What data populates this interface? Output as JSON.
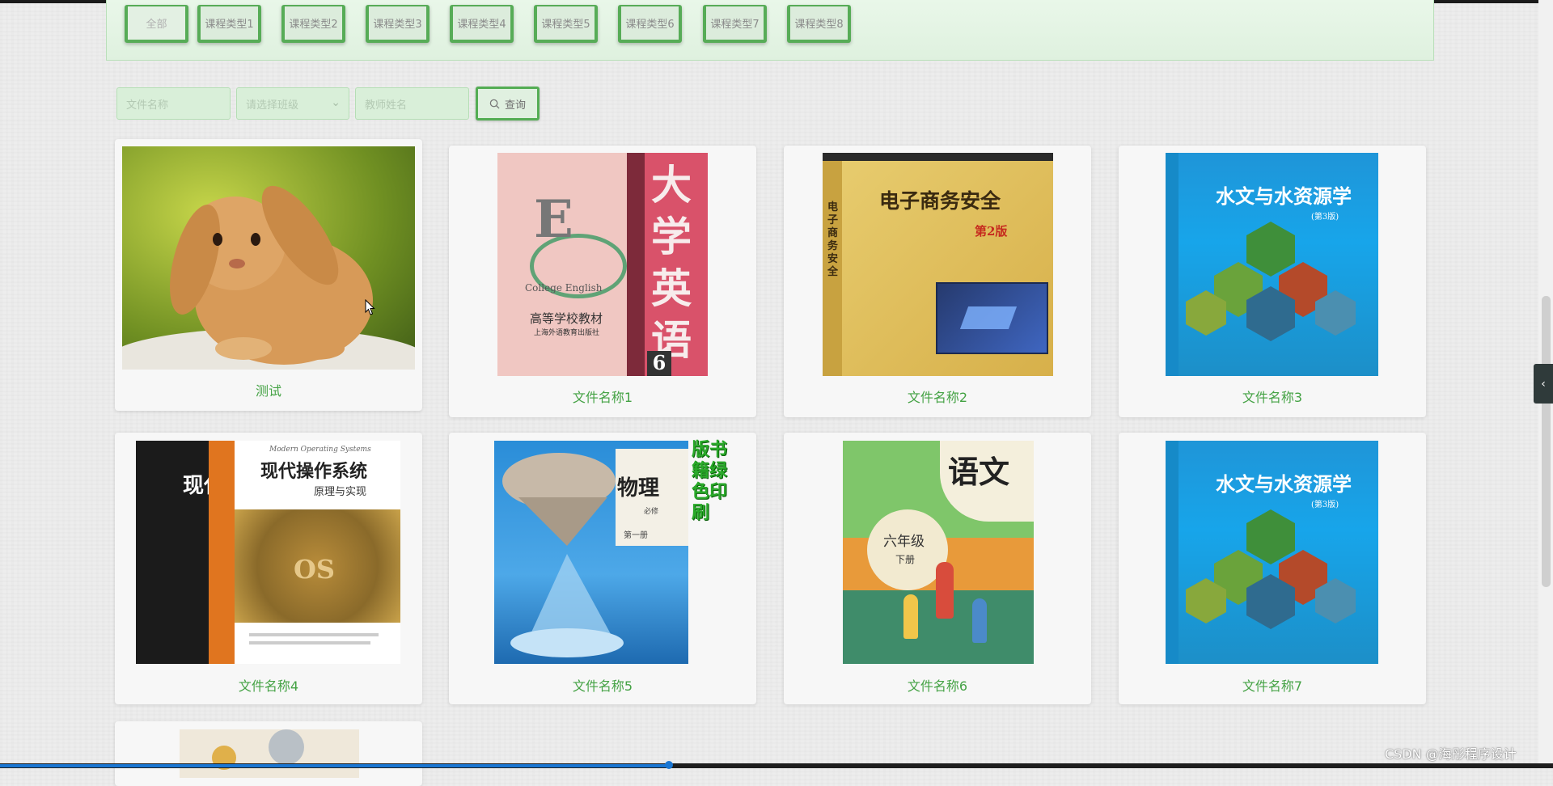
{
  "course_types": [
    "全部",
    "课程类型1",
    "课程类型2",
    "课程类型3",
    "课程类型4",
    "课程类型5",
    "课程类型6",
    "课程类型7",
    "课程类型8"
  ],
  "search": {
    "file_name_placeholder": "文件名称",
    "class_select_placeholder": "请选择班级",
    "teacher_placeholder": "教师姓名",
    "query_label": "查询"
  },
  "files": [
    {
      "name": "测试",
      "cover": "rabbit-photo"
    },
    {
      "name": "文件名称1",
      "cover": "book-college-english"
    },
    {
      "name": "文件名称2",
      "cover": "book-ecommerce-security"
    },
    {
      "name": "文件名称3",
      "cover": "book-hydrology"
    },
    {
      "name": "文件名称4",
      "cover": "book-modern-os"
    },
    {
      "name": "文件名称5",
      "cover": "book-physics"
    },
    {
      "name": "文件名称6",
      "cover": "book-chinese-grade6"
    },
    {
      "name": "文件名称7",
      "cover": "book-hydrology"
    }
  ],
  "covers": {
    "english_title": "大学英语",
    "english_sub": "College English",
    "english_pub1": "高等学校教材",
    "english_pub2": "上海外语教育出版社",
    "english_vol": "6",
    "ecom_title": "电子商务安全",
    "ecom_edition": "第2版",
    "hydro_title": "水文与水资源学",
    "hydro_edition": "(第3版)",
    "os_title": "现代操作系统",
    "os_sub": "原理与实现",
    "os_en": "Modern Operating Systems",
    "os_logo": "OS",
    "os_spine": "现代",
    "physics_title": "物理",
    "physics_req": "必修",
    "physics_vol": "第一册",
    "physics_promo": "版书籍绿色印刷",
    "chinese_title": "语文",
    "chinese_grade": "六年级",
    "chinese_vol": "下册"
  },
  "watermark": "CSDN @海彤程序设计"
}
